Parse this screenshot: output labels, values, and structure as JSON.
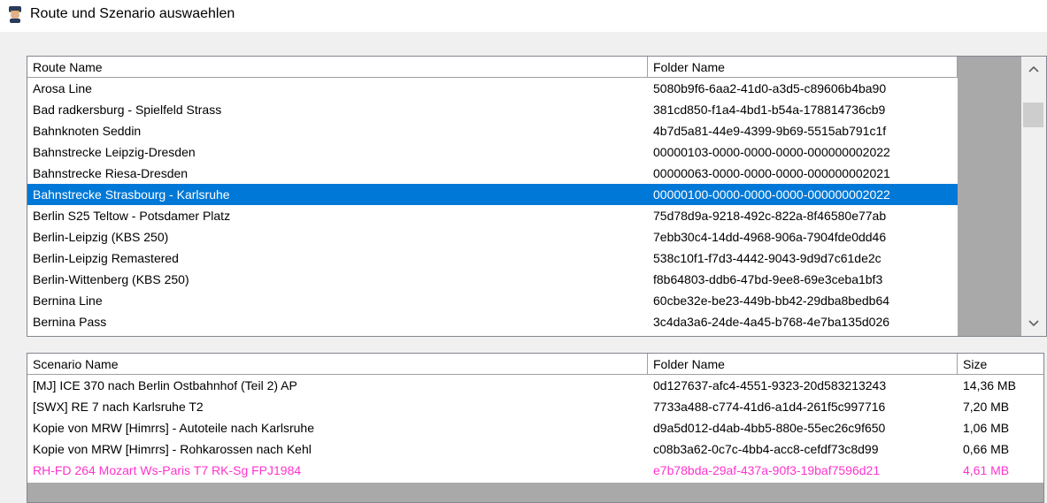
{
  "window": {
    "title": "Route und Szenario auswaehlen"
  },
  "route_table": {
    "columns": [
      "Route Name",
      "Folder Name"
    ],
    "selected_index": 5,
    "rows": [
      {
        "name": "Arosa Line",
        "folder": "5080b9f6-6aa2-41d0-a3d5-c89606b4ba90"
      },
      {
        "name": "Bad radkersburg - Spielfeld Strass",
        "folder": "381cd850-f1a4-4bd1-b54a-178814736cb9"
      },
      {
        "name": "Bahnknoten Seddin",
        "folder": "4b7d5a81-44e9-4399-9b69-5515ab791c1f"
      },
      {
        "name": "Bahnstrecke Leipzig-Dresden",
        "folder": "00000103-0000-0000-0000-000000002022"
      },
      {
        "name": "Bahnstrecke Riesa-Dresden",
        "folder": "00000063-0000-0000-0000-000000002021"
      },
      {
        "name": "Bahnstrecke Strasbourg - Karlsruhe",
        "folder": "00000100-0000-0000-0000-000000002022"
      },
      {
        "name": "Berlin S25 Teltow - Potsdamer Platz",
        "folder": "75d78d9a-9218-492c-822a-8f46580e77ab"
      },
      {
        "name": "Berlin-Leipzig (KBS 250)",
        "folder": "7ebb30c4-14dd-4968-906a-7904fde0dd46"
      },
      {
        "name": "Berlin-Leipzig Remastered",
        "folder": "538c10f1-f7d3-4442-9043-9d9d7c61de2c"
      },
      {
        "name": "Berlin-Wittenberg (KBS 250)",
        "folder": "f8b64803-ddb6-47bd-9ee8-69e3ceba1bf3"
      },
      {
        "name": "Bernina Line",
        "folder": "60cbe32e-be23-449b-bb42-29dba8bedb64"
      },
      {
        "name": "Bernina Pass",
        "folder": "3c4da3a6-24de-4a45-b768-4e7ba135d026"
      }
    ]
  },
  "scenario_table": {
    "columns": [
      "Scenario Name",
      "Folder Name",
      "Size"
    ],
    "rows": [
      {
        "name": "[MJ] ICE 370 nach Berlin Ostbahnhof (Teil 2) AP",
        "folder": "0d127637-afc4-4551-9323-20d583213243",
        "size": "14,36 MB",
        "color": ""
      },
      {
        "name": "[SWX] RE 7 nach Karlsruhe T2",
        "folder": "7733a488-c774-41d6-a1d4-261f5c997716",
        "size": "7,20 MB",
        "color": ""
      },
      {
        "name": "Kopie von MRW [Himrrs] - Autoteile nach Karlsruhe",
        "folder": "d9a5d012-d4ab-4bb5-880e-55ec26c9f650",
        "size": "1,06 MB",
        "color": ""
      },
      {
        "name": "Kopie von MRW [Himrrs] - Rohkarossen nach Kehl",
        "folder": "c08b3a62-0c7c-4bb4-acc8-cefdf73c8d99",
        "size": "0,66 MB",
        "color": ""
      },
      {
        "name": "RH-FD 264 Mozart Ws-Paris T7 RK-Sg FPJ1984",
        "folder": "e7b78bda-29af-437a-90f3-19baf7596d21",
        "size": "4,61 MB",
        "color": "#ff33cc"
      }
    ]
  },
  "colors": {
    "selection": "#0078d7",
    "highlight_text": "#ff33cc",
    "empty_area": "#a9a9a9"
  },
  "icons": {
    "app": "train-driver-icon",
    "scroll_up": "chevron-up-icon",
    "scroll_down": "chevron-down-icon"
  }
}
